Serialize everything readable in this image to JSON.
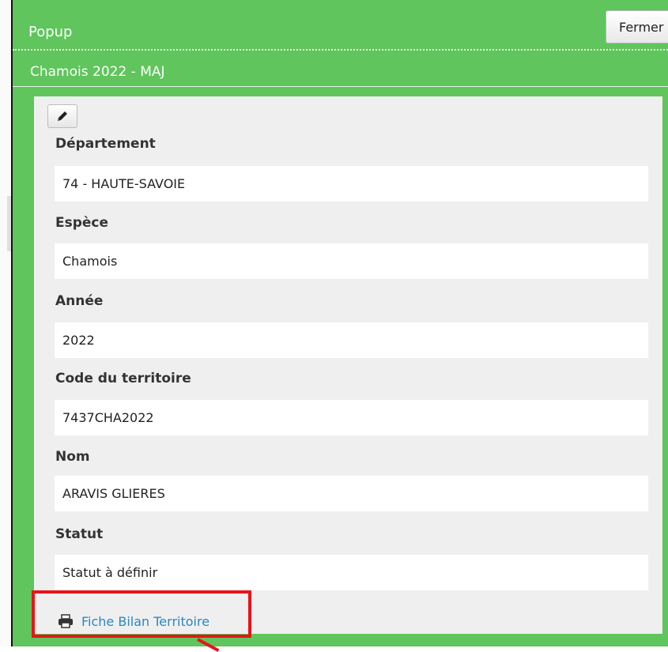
{
  "window": {
    "title": "Popup",
    "close_label": "Fermer"
  },
  "layer": {
    "title": "Chamois 2022 - MAJ"
  },
  "toolbar": {
    "edit_icon": "pencil-icon"
  },
  "fields": [
    {
      "label": "Département",
      "value": "74 - HAUTE-SAVOIE"
    },
    {
      "label": "Espèce",
      "value": "Chamois"
    },
    {
      "label": "Année",
      "value": "2022"
    },
    {
      "label": "Code du territoire",
      "value": "7437CHA2022"
    },
    {
      "label": "Nom",
      "value": "ARAVIS GLIERES"
    },
    {
      "label": "Statut",
      "value": "Statut à définir"
    }
  ],
  "report_link": {
    "label": "Fiche Bilan Territoire",
    "icon": "printer-icon"
  },
  "colors": {
    "header_green": "#5fc55c",
    "panel_gray": "#efefef",
    "link_blue": "#2a87c4",
    "highlight_red": "#e8141a"
  }
}
